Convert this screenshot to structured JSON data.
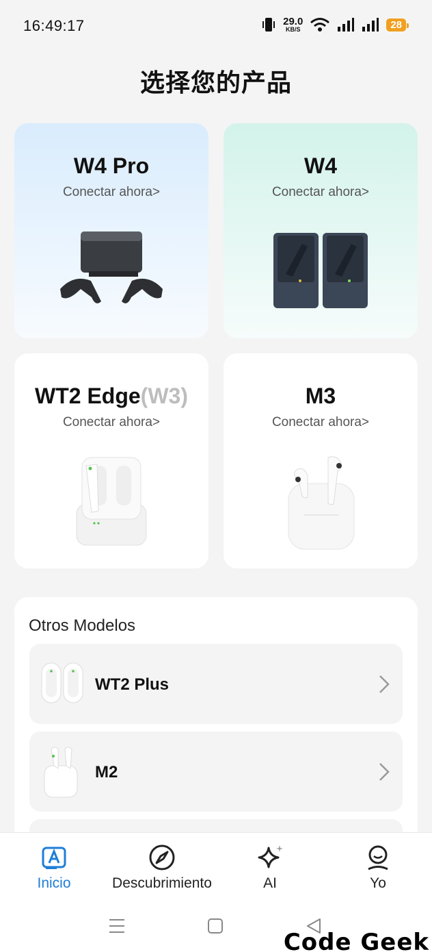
{
  "status": {
    "time": "16:49:17",
    "speed_value": "29.0",
    "speed_unit": "KB/S",
    "battery": "28",
    "icons": [
      "vibrate-icon",
      "wifi-icon",
      "signal-icon",
      "signal-icon",
      "battery-icon"
    ]
  },
  "page_title": "选择您的产品",
  "products": [
    {
      "name": "W4 Pro",
      "link": "Conectar ahora>",
      "icon": "w4-pro-image"
    },
    {
      "name": "W4",
      "link": "Conectar ahora>",
      "icon": "w4-image"
    },
    {
      "name": "WT2 Edge",
      "name_suffix": "(W3)",
      "link": "Conectar ahora>",
      "icon": "wt2-edge-image"
    },
    {
      "name": "M3",
      "link": "Conectar ahora>",
      "icon": "m3-image"
    }
  ],
  "others": {
    "title": "Otros Modelos",
    "items": [
      {
        "name": "WT2 Plus",
        "icon": "wt2-plus-image"
      },
      {
        "name": "M2",
        "icon": "m2-image"
      }
    ]
  },
  "nav": {
    "items": [
      {
        "label": "Inicio",
        "icon": "home-a-icon",
        "active": true
      },
      {
        "label": "Descubrimiento",
        "icon": "compass-icon",
        "active": false
      },
      {
        "label": "AI",
        "icon": "sparkle-icon",
        "active": false
      },
      {
        "label": "Yo",
        "icon": "profile-icon",
        "active": false
      }
    ]
  },
  "watermark": "Code Geek",
  "colors": {
    "accent": "#1e7ed8",
    "battery": "#f0a020"
  }
}
